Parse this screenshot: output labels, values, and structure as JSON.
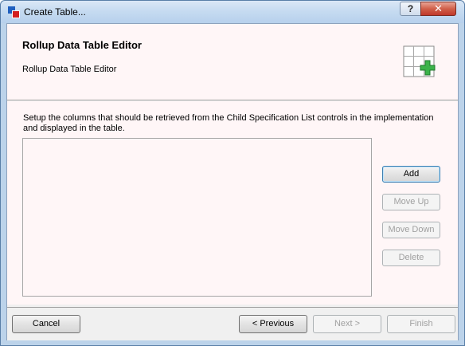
{
  "window": {
    "title": "Create Table...",
    "help_label": "?",
    "close_label": "✕"
  },
  "header": {
    "title": "Rollup Data Table Editor",
    "subtitle": "Rollup Data Table Editor",
    "icon": "table-add-icon"
  },
  "main": {
    "instruction": "Setup the columns that should be retrieved from the Child Specification List controls in the implementation and displayed in the table.",
    "columns": []
  },
  "side_buttons": {
    "add": "Add",
    "move_up": "Move Up",
    "move_down": "Move Down",
    "delete": "Delete"
  },
  "footer": {
    "cancel": "Cancel",
    "previous": "< Previous",
    "next": "Next >",
    "finish": "Finish"
  },
  "colors": {
    "panel_background": "#fff6f7",
    "window_frame": "#bcd3ea",
    "close_button": "#c0392b",
    "plus_icon": "#3bb34a"
  }
}
